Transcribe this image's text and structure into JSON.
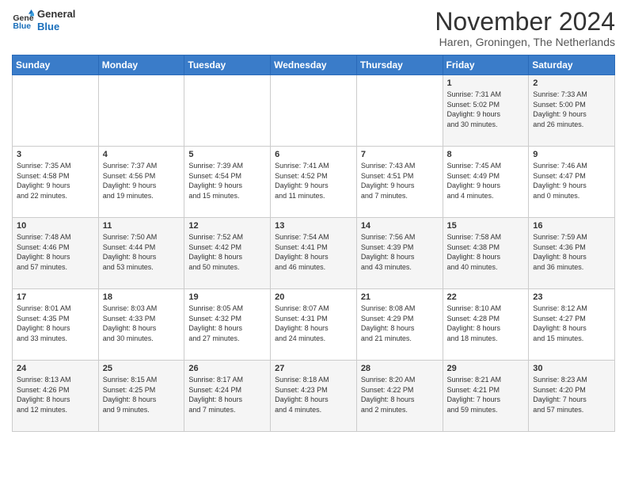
{
  "header": {
    "logo_line1": "General",
    "logo_line2": "Blue",
    "month_title": "November 2024",
    "subtitle": "Haren, Groningen, The Netherlands"
  },
  "days_of_week": [
    "Sunday",
    "Monday",
    "Tuesday",
    "Wednesday",
    "Thursday",
    "Friday",
    "Saturday"
  ],
  "weeks": [
    [
      {
        "day": "",
        "info": ""
      },
      {
        "day": "",
        "info": ""
      },
      {
        "day": "",
        "info": ""
      },
      {
        "day": "",
        "info": ""
      },
      {
        "day": "",
        "info": ""
      },
      {
        "day": "1",
        "info": "Sunrise: 7:31 AM\nSunset: 5:02 PM\nDaylight: 9 hours\nand 30 minutes."
      },
      {
        "day": "2",
        "info": "Sunrise: 7:33 AM\nSunset: 5:00 PM\nDaylight: 9 hours\nand 26 minutes."
      }
    ],
    [
      {
        "day": "3",
        "info": "Sunrise: 7:35 AM\nSunset: 4:58 PM\nDaylight: 9 hours\nand 22 minutes."
      },
      {
        "day": "4",
        "info": "Sunrise: 7:37 AM\nSunset: 4:56 PM\nDaylight: 9 hours\nand 19 minutes."
      },
      {
        "day": "5",
        "info": "Sunrise: 7:39 AM\nSunset: 4:54 PM\nDaylight: 9 hours\nand 15 minutes."
      },
      {
        "day": "6",
        "info": "Sunrise: 7:41 AM\nSunset: 4:52 PM\nDaylight: 9 hours\nand 11 minutes."
      },
      {
        "day": "7",
        "info": "Sunrise: 7:43 AM\nSunset: 4:51 PM\nDaylight: 9 hours\nand 7 minutes."
      },
      {
        "day": "8",
        "info": "Sunrise: 7:45 AM\nSunset: 4:49 PM\nDaylight: 9 hours\nand 4 minutes."
      },
      {
        "day": "9",
        "info": "Sunrise: 7:46 AM\nSunset: 4:47 PM\nDaylight: 9 hours\nand 0 minutes."
      }
    ],
    [
      {
        "day": "10",
        "info": "Sunrise: 7:48 AM\nSunset: 4:46 PM\nDaylight: 8 hours\nand 57 minutes."
      },
      {
        "day": "11",
        "info": "Sunrise: 7:50 AM\nSunset: 4:44 PM\nDaylight: 8 hours\nand 53 minutes."
      },
      {
        "day": "12",
        "info": "Sunrise: 7:52 AM\nSunset: 4:42 PM\nDaylight: 8 hours\nand 50 minutes."
      },
      {
        "day": "13",
        "info": "Sunrise: 7:54 AM\nSunset: 4:41 PM\nDaylight: 8 hours\nand 46 minutes."
      },
      {
        "day": "14",
        "info": "Sunrise: 7:56 AM\nSunset: 4:39 PM\nDaylight: 8 hours\nand 43 minutes."
      },
      {
        "day": "15",
        "info": "Sunrise: 7:58 AM\nSunset: 4:38 PM\nDaylight: 8 hours\nand 40 minutes."
      },
      {
        "day": "16",
        "info": "Sunrise: 7:59 AM\nSunset: 4:36 PM\nDaylight: 8 hours\nand 36 minutes."
      }
    ],
    [
      {
        "day": "17",
        "info": "Sunrise: 8:01 AM\nSunset: 4:35 PM\nDaylight: 8 hours\nand 33 minutes."
      },
      {
        "day": "18",
        "info": "Sunrise: 8:03 AM\nSunset: 4:33 PM\nDaylight: 8 hours\nand 30 minutes."
      },
      {
        "day": "19",
        "info": "Sunrise: 8:05 AM\nSunset: 4:32 PM\nDaylight: 8 hours\nand 27 minutes."
      },
      {
        "day": "20",
        "info": "Sunrise: 8:07 AM\nSunset: 4:31 PM\nDaylight: 8 hours\nand 24 minutes."
      },
      {
        "day": "21",
        "info": "Sunrise: 8:08 AM\nSunset: 4:29 PM\nDaylight: 8 hours\nand 21 minutes."
      },
      {
        "day": "22",
        "info": "Sunrise: 8:10 AM\nSunset: 4:28 PM\nDaylight: 8 hours\nand 18 minutes."
      },
      {
        "day": "23",
        "info": "Sunrise: 8:12 AM\nSunset: 4:27 PM\nDaylight: 8 hours\nand 15 minutes."
      }
    ],
    [
      {
        "day": "24",
        "info": "Sunrise: 8:13 AM\nSunset: 4:26 PM\nDaylight: 8 hours\nand 12 minutes."
      },
      {
        "day": "25",
        "info": "Sunrise: 8:15 AM\nSunset: 4:25 PM\nDaylight: 8 hours\nand 9 minutes."
      },
      {
        "day": "26",
        "info": "Sunrise: 8:17 AM\nSunset: 4:24 PM\nDaylight: 8 hours\nand 7 minutes."
      },
      {
        "day": "27",
        "info": "Sunrise: 8:18 AM\nSunset: 4:23 PM\nDaylight: 8 hours\nand 4 minutes."
      },
      {
        "day": "28",
        "info": "Sunrise: 8:20 AM\nSunset: 4:22 PM\nDaylight: 8 hours\nand 2 minutes."
      },
      {
        "day": "29",
        "info": "Sunrise: 8:21 AM\nSunset: 4:21 PM\nDaylight: 7 hours\nand 59 minutes."
      },
      {
        "day": "30",
        "info": "Sunrise: 8:23 AM\nSunset: 4:20 PM\nDaylight: 7 hours\nand 57 minutes."
      }
    ]
  ]
}
